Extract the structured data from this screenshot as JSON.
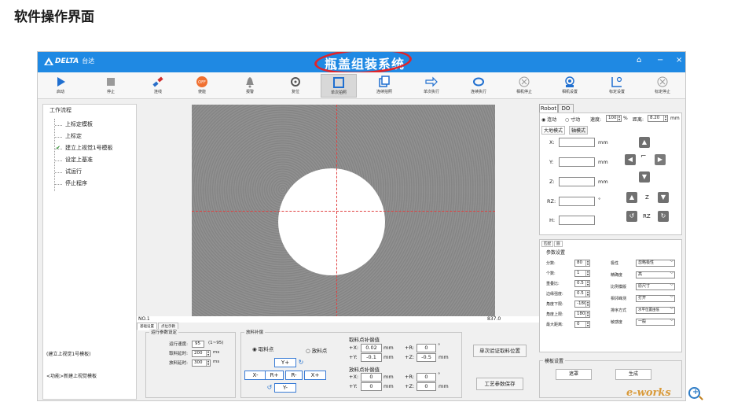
{
  "heading": "软件操作界面",
  "app": {
    "brand": "DELTA",
    "brand_cn": "台达",
    "title": "瓶盖组装系统",
    "win_buttons": [
      "⌂",
      "−",
      "×"
    ]
  },
  "toolbar": [
    {
      "label": "启动",
      "icon": "play-icon"
    },
    {
      "label": "停止",
      "icon": "stop-icon"
    },
    {
      "label": "连线",
      "icon": "plug-icon"
    },
    {
      "label": "使能",
      "icon": "off-badge-icon",
      "badge": "OFF"
    },
    {
      "label": "报警",
      "icon": "bell-icon"
    },
    {
      "label": "复位",
      "icon": "reset-icon"
    },
    {
      "label": "单次拍照",
      "icon": "frame-icon",
      "active": true
    },
    {
      "label": "连续拍照",
      "icon": "copy-icon"
    },
    {
      "label": "单次执行",
      "icon": "arrow-right-icon"
    },
    {
      "label": "连续执行",
      "icon": "loop-icon"
    },
    {
      "label": "相机停止",
      "icon": "cancel-icon"
    },
    {
      "label": "相机设置",
      "icon": "camera-settings-icon"
    },
    {
      "label": "标定设置",
      "icon": "calibrate-icon"
    },
    {
      "label": "标定停止",
      "icon": "cancel-icon"
    }
  ],
  "left": {
    "title": "工作流程",
    "tree": [
      {
        "label": "上标定模板",
        "checked": false
      },
      {
        "label": "上标定",
        "checked": false
      },
      {
        "label": "建立上视觉1号模板",
        "checked": true
      },
      {
        "label": "设定上基准",
        "checked": false
      },
      {
        "label": "试运行",
        "checked": false
      },
      {
        "label": "停止程序",
        "checked": false
      }
    ],
    "status1": "(建立上视觉1号模板)",
    "status2": "<功能>新建上视觉模板"
  },
  "camera": {
    "left_label": "NO.1",
    "right_label": "837.0"
  },
  "bottom_tabs": [
    "基础设置",
    "点位示教"
  ],
  "run": {
    "title": "运行参数设定",
    "speed_label": "运行速度:",
    "speed": "95",
    "speed_range": "(1~95)",
    "pick_delay_label": "取料延时:",
    "pick_delay": "200",
    "place_delay_label": "放料延时:",
    "place_delay": "300",
    "unit": "ms"
  },
  "feed": {
    "title": "放料补偿",
    "radio_pick": "取料点",
    "radio_place": "放料点",
    "jog": {
      "yplus": "Y+",
      "yminus": "Y-",
      "xminus": "X-",
      "xplus": "X+",
      "rplus": "R+",
      "rminus": "R-"
    },
    "pick_title": "取料点补偿值",
    "place_title": "放料点补偿值",
    "pick": {
      "x": "0.02",
      "y": "-0.1",
      "r": "0",
      "z": "-0.5"
    },
    "place": {
      "x": "0",
      "y": "0",
      "r": "0",
      "z": "0"
    },
    "lab": {
      "x": "+X:",
      "y": "+Y:",
      "r": "+R:",
      "z": "+Z:",
      "mm": "mm",
      "deg": "°"
    },
    "btn_verify": "单次验证取料位置",
    "btn_save": "工艺参数保存"
  },
  "right": {
    "tabs": [
      "Robot",
      "DO"
    ],
    "mode_continuous": "连动",
    "mode_inch": "寸动",
    "speed_label": "速度:",
    "speed": "100",
    "pct": "%",
    "dist_label": "距离:",
    "dist": "8.20",
    "mm": "mm",
    "subtabs": [
      "大地模式",
      "轴模式"
    ],
    "axes": {
      "x": "X:",
      "y": "Y:",
      "z": "Z:",
      "rz": "RZ:",
      "h": "H:"
    },
    "deg": "°",
    "z_label": "Z",
    "rz_label": "RZ",
    "param_tabs": [
      "匹配",
      "圆"
    ],
    "param_title": "参数设置",
    "params_left": [
      {
        "label": "分数:",
        "value": "80"
      },
      {
        "label": "个数:",
        "value": "1"
      },
      {
        "label": "重叠比:",
        "value": "0.5"
      },
      {
        "label": "边缘强度:",
        "value": "0.5"
      },
      {
        "label": "角度下限:",
        "value": "-180"
      },
      {
        "label": "角度上限:",
        "value": "180"
      },
      {
        "label": "最大距离:",
        "value": "0"
      }
    ],
    "params_right": [
      {
        "label": "极性",
        "value": "忽略极性"
      },
      {
        "label": "精确度",
        "value": "高"
      },
      {
        "label": "比例模版",
        "value": "原尺寸"
      },
      {
        "label": "相邻峰测",
        "value": "打开"
      },
      {
        "label": "排序方式",
        "value": "水平位置由低"
      },
      {
        "label": "敏感度",
        "value": "一般"
      }
    ],
    "template_title": "模板设置",
    "btn_mask": "遮罩",
    "btn_gen": "生成"
  },
  "watermark": "e-works"
}
